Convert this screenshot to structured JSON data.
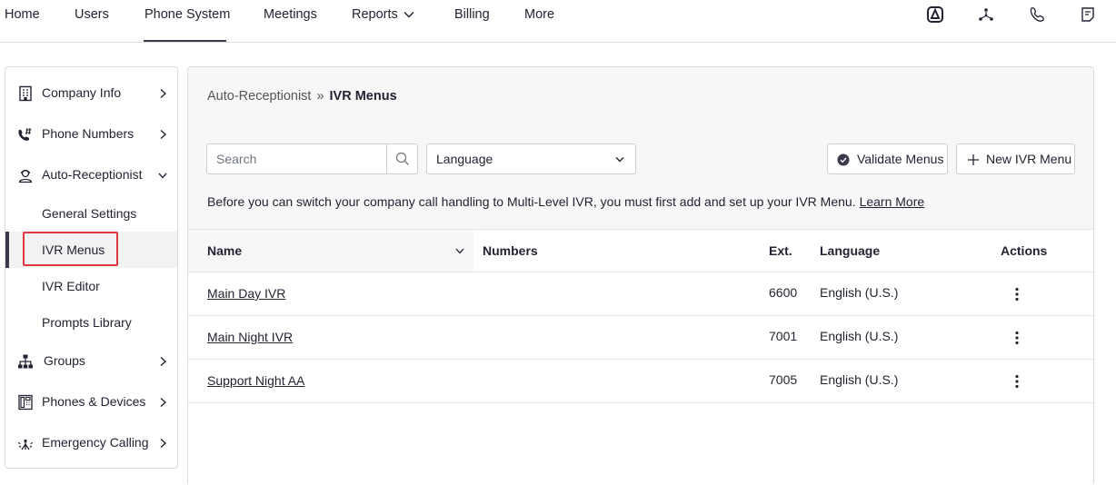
{
  "topnav": {
    "items": [
      "Home",
      "Users",
      "Phone System",
      "Meetings",
      "Reports",
      "Billing",
      "More"
    ],
    "active": "Phone System",
    "icons": [
      "zoom-apps-icon",
      "network-icon",
      "phone-icon",
      "notes-icon"
    ]
  },
  "sidebar": {
    "items": [
      {
        "label": "Company Info",
        "icon": "building-icon"
      },
      {
        "label": "Phone Numbers",
        "icon": "phone-number-icon"
      },
      {
        "label": "Auto-Receptionist",
        "icon": "receptionist-icon"
      },
      {
        "label": "Groups",
        "icon": "groups-icon"
      },
      {
        "label": "Phones & Devices",
        "icon": "desk-phone-icon"
      },
      {
        "label": "Emergency Calling",
        "icon": "emergency-icon"
      }
    ],
    "sub_items": [
      "General Settings",
      "IVR Menus",
      "IVR Editor",
      "Prompts Library"
    ],
    "active_sub": "IVR Menus"
  },
  "breadcrumb": {
    "parent": "Auto-Receptionist",
    "current": "IVR Menus"
  },
  "toolbar": {
    "search_placeholder": "Search",
    "language_label": "Language",
    "validate_label": "Validate Menus",
    "new_label": "New IVR Menu"
  },
  "info": {
    "text": "Before you can switch your company call handling to Multi-Level IVR, you must first add and set up your IVR Menu.",
    "link": "Learn More"
  },
  "table": {
    "headers": {
      "name": "Name",
      "numbers": "Numbers",
      "ext": "Ext.",
      "language": "Language",
      "actions": "Actions"
    },
    "rows": [
      {
        "name": "Main Day IVR",
        "numbers": "",
        "ext": "6600",
        "language": "English (U.S.)"
      },
      {
        "name": "Main Night IVR",
        "numbers": "",
        "ext": "7001",
        "language": "English (U.S.)"
      },
      {
        "name": "Support Night AA",
        "numbers": "",
        "ext": "7005",
        "language": "English (U.S.)"
      }
    ]
  },
  "colors": {
    "highlight": "#e0383e",
    "active_bar": "#39394d",
    "text": "#232333"
  }
}
